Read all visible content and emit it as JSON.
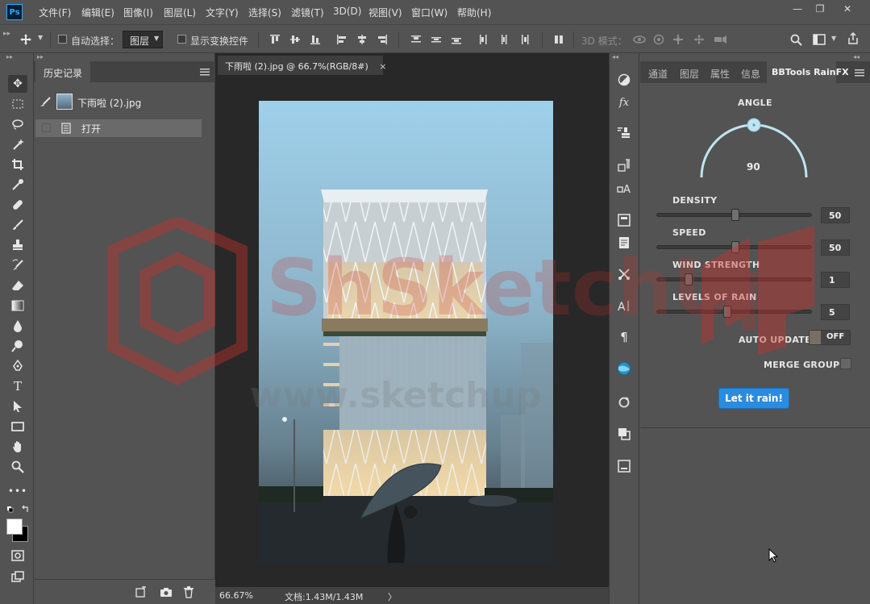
{
  "app": {
    "logo": "Ps",
    "menu": [
      "文件(F)",
      "编辑(E)",
      "图像(I)",
      "图层(L)",
      "文字(Y)",
      "选择(S)",
      "滤镜(T)",
      "3D(D)",
      "视图(V)",
      "窗口(W)",
      "帮助(H)"
    ],
    "window_controls": {
      "minimize": "—",
      "restore": "❐",
      "close": "✕"
    }
  },
  "options_bar": {
    "auto_select_label": "自动选择：",
    "auto_select_value": "图层",
    "show_transform_label": "显示变换控件",
    "mode_3d_label": "3D 模式："
  },
  "history_panel": {
    "tab_label": "历史记录",
    "snapshot_name": "下雨啦 (2).jpg",
    "steps": [
      "打开"
    ]
  },
  "document": {
    "tab_title": "下雨啦 (2).jpg @ 66.7%(RGB/8#)",
    "close_glyph": "×",
    "zoom": "66.67%",
    "doc_size": "文档:1.43M/1.43M",
    "arrow": "〉"
  },
  "right_panel": {
    "tabs": [
      "通道",
      "图层",
      "属性",
      "信息"
    ],
    "active_tab": "BBTools RainFX",
    "angle_label": "ANGLE",
    "angle_value": "90",
    "sliders": [
      {
        "label": "DENSITY",
        "value": "50",
        "fraction": 0.5
      },
      {
        "label": "SPEED",
        "value": "50",
        "fraction": 0.5
      },
      {
        "label": "WIND STRENGTH",
        "value": "1",
        "fraction": 0.2
      },
      {
        "label": "LEVELS OF RAIN",
        "value": "5",
        "fraction": 0.45
      }
    ],
    "auto_update_label": "AUTO UPDATE",
    "auto_update_state": "OFF",
    "merge_group_label": "MERGE GROUP",
    "action_button": "Let it rain!"
  },
  "watermark": {
    "brand": "ShSketchUp",
    "url": "www.sketchup"
  },
  "colors": {
    "chrome": "#535353",
    "document_bg": "#282828",
    "accent_button": "#2a8ce0",
    "angle_arc": "#bfe4f2",
    "watermark_red": "#c9302c"
  }
}
